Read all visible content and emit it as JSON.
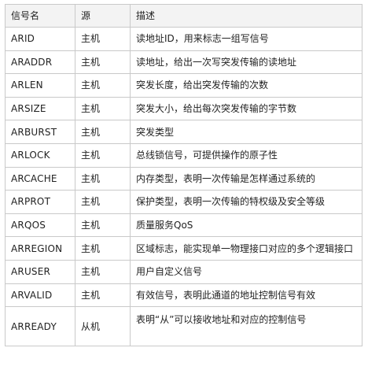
{
  "header": {
    "name": "信号名",
    "source": "源",
    "description": "描述"
  },
  "rows": [
    {
      "name": "ARID",
      "source": "主机",
      "description": "读地址ID，用来标志一组写信号"
    },
    {
      "name": "ARADDR",
      "source": "主机",
      "description": "读地址，给出一次写突发传输的读地址"
    },
    {
      "name": "ARLEN",
      "source": "主机",
      "description": "突发长度，给出突发传输的次数"
    },
    {
      "name": "ARSIZE",
      "source": "主机",
      "description": "突发大小，给出每次突发传输的字节数"
    },
    {
      "name": "ARBURST",
      "source": "主机",
      "description": "突发类型"
    },
    {
      "name": "ARLOCK",
      "source": "主机",
      "description": "总线锁信号，可提供操作的原子性"
    },
    {
      "name": "ARCACHE",
      "source": "主机",
      "description": "内存类型，表明一次传输是怎样通过系统的"
    },
    {
      "name": "ARPROT",
      "source": "主机",
      "description": "保护类型，表明一次传输的特权级及安全等级"
    },
    {
      "name": "ARQOS",
      "source": "主机",
      "description": "质量服务QoS"
    },
    {
      "name": "ARREGION",
      "source": "主机",
      "description": "区域标志，能实现单一物理接口对应的多个逻辑接口"
    },
    {
      "name": "ARUSER",
      "source": "主机",
      "description": "用户自定义信号"
    },
    {
      "name": "ARVALID",
      "source": "主机",
      "description": "有效信号，表明此通道的地址控制信号有效"
    },
    {
      "name": "ARREADY",
      "source": "从机",
      "description": "表明“从”可以接收地址和对应的控制信号"
    }
  ]
}
